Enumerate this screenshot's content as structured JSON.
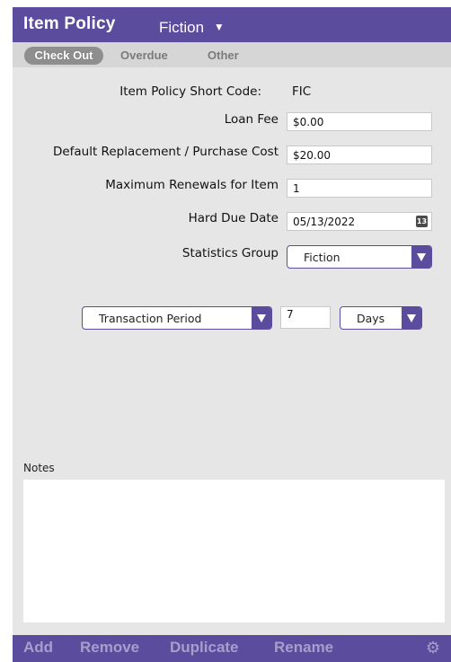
{
  "header": {
    "title": "Item Policy",
    "policy_selector": "Fiction",
    "selector_arrow": "▼"
  },
  "tabs": [
    {
      "label": "Check Out",
      "active": true
    },
    {
      "label": "Overdue",
      "active": false
    },
    {
      "label": "Other",
      "active": false
    }
  ],
  "form": {
    "short_code_label": "Item Policy Short Code:",
    "short_code_value": "FIC",
    "loan_fee_label": "Loan Fee",
    "loan_fee_value": "$0.00",
    "replacement_cost_label": "Default Replacement / Purchase Cost",
    "replacement_cost_value": "$20.00",
    "max_renewals_label": "Maximum Renewals for Item",
    "max_renewals_value": "1",
    "hard_due_date_label": "Hard Due Date",
    "hard_due_date_value": "05/13/2022",
    "calendar_day": "13",
    "statistics_group_label": "Statistics Group",
    "statistics_group_value": "Fiction"
  },
  "transaction": {
    "period_type": "Transaction Period",
    "count": "7",
    "unit": "Days"
  },
  "notes": {
    "label": "Notes",
    "value": ""
  },
  "footer": {
    "add": "Add",
    "remove": "Remove",
    "duplicate": "Duplicate",
    "rename": "Rename",
    "settings_icon": "gear-icon"
  },
  "colors": {
    "accent": "#5c4c9e",
    "footer_text": "#a79fcb"
  }
}
